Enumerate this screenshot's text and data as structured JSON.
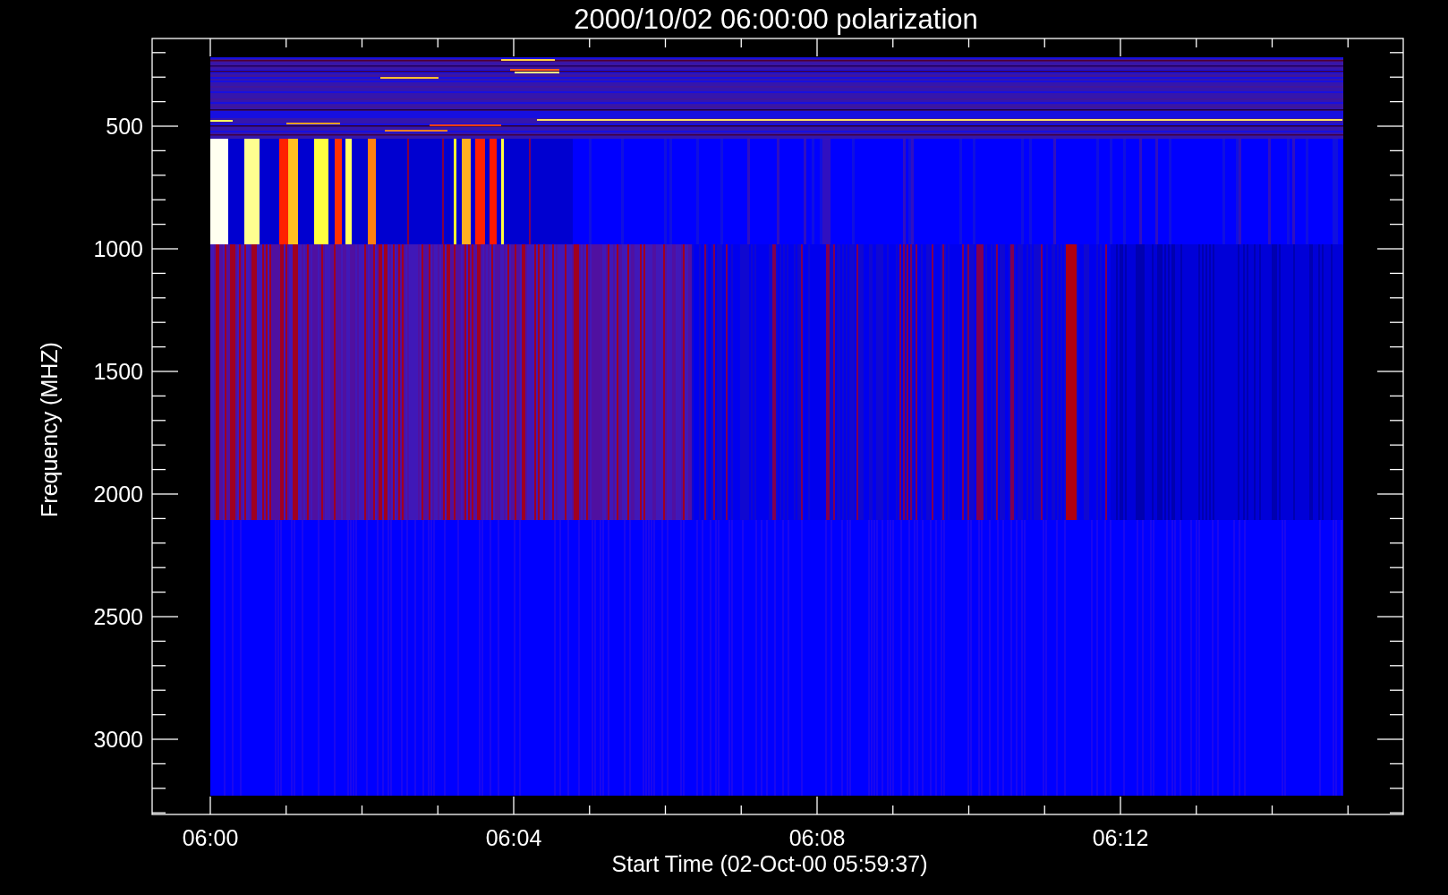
{
  "plot": {
    "title": "2000/10/02 06:00:00 polarization",
    "y_axis": {
      "label": "Frequency (MHZ)",
      "tick_labels": [
        "500",
        "1000",
        "1500",
        "2000",
        "2500",
        "3000"
      ]
    },
    "x_axis": {
      "label": "Start Time (02-Oct-00 05:59:37)",
      "tick_labels": [
        "06:00",
        "06:04",
        "06:08",
        "06:12"
      ]
    }
  }
}
